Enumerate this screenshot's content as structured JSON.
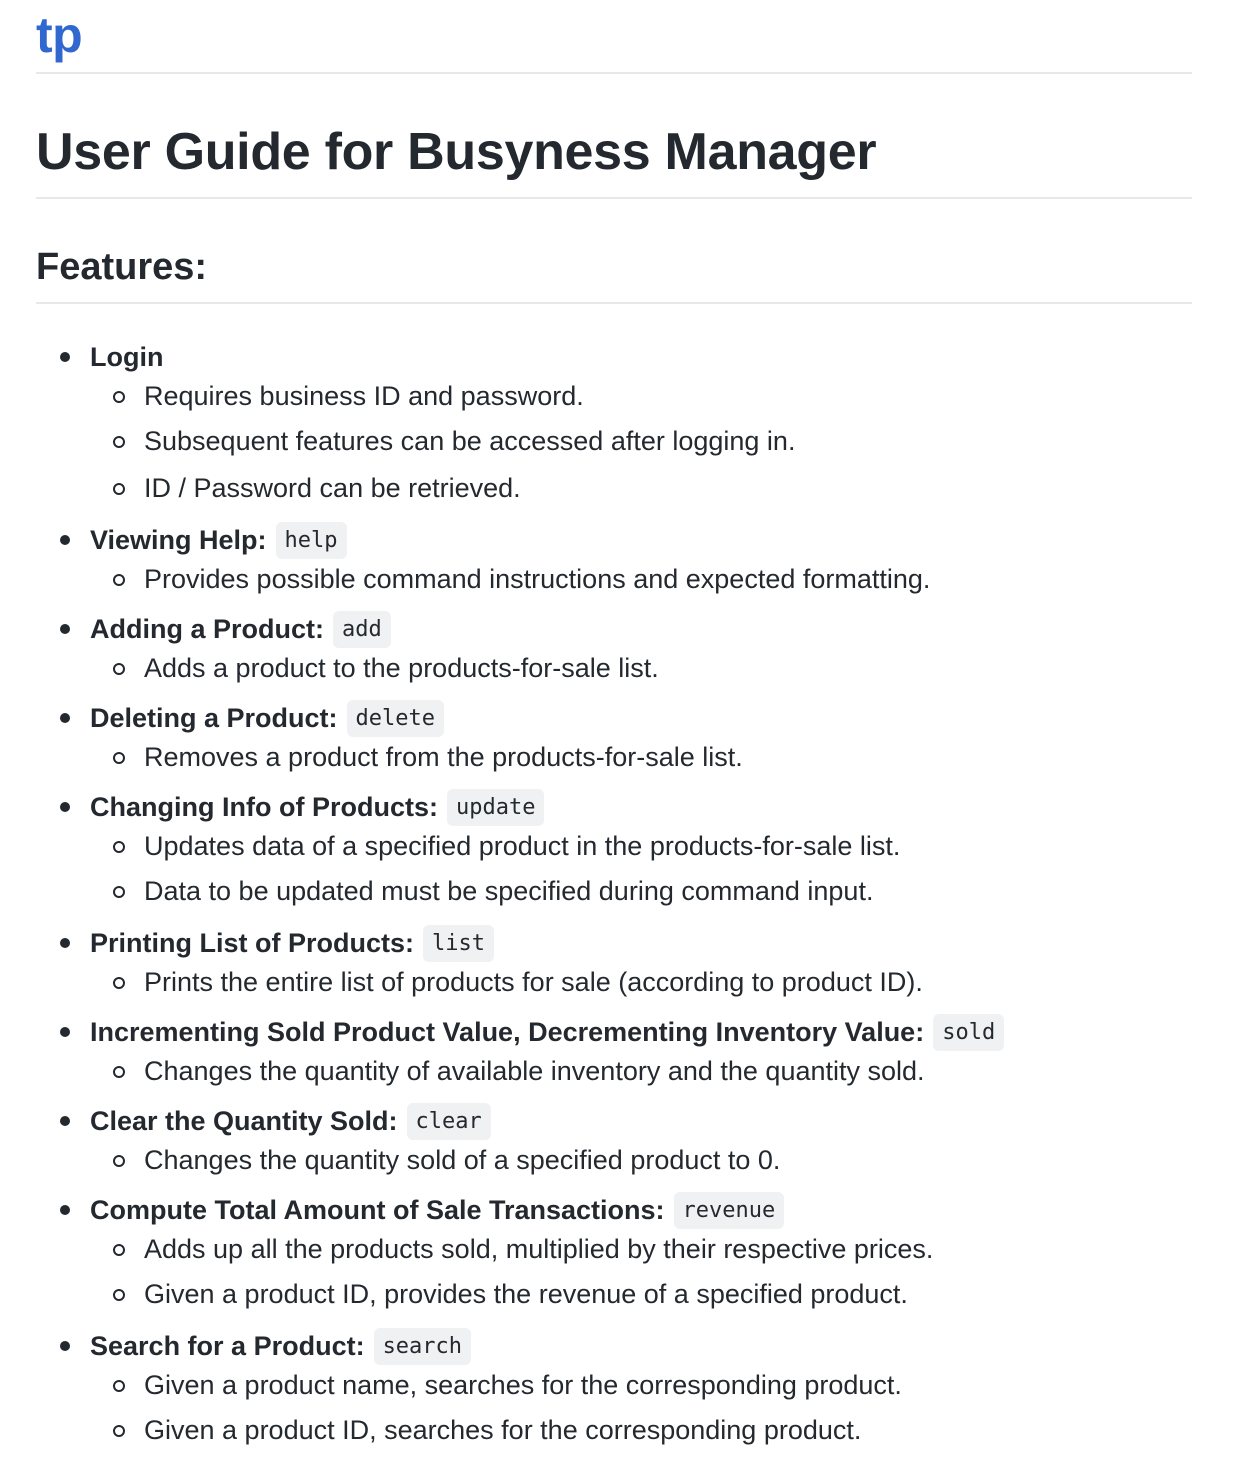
{
  "site": {
    "title": "tp"
  },
  "page": {
    "title": "User Guide for Busyness Manager",
    "section_heading": "Features:"
  },
  "features": [
    {
      "title": "Login",
      "command": "",
      "details": [
        "Requires business ID and password.",
        "Subsequent features can be accessed after logging in.",
        "ID / Password can be retrieved."
      ]
    },
    {
      "title": "Viewing Help:",
      "command": "help",
      "details": [
        "Provides possible command instructions and expected formatting."
      ]
    },
    {
      "title": "Adding a Product:",
      "command": "add",
      "details": [
        "Adds a product to the products-for-sale list."
      ]
    },
    {
      "title": "Deleting a Product:",
      "command": "delete",
      "details": [
        "Removes a product from the products-for-sale list."
      ]
    },
    {
      "title": "Changing Info of Products:",
      "command": "update",
      "details": [
        "Updates data of a specified product in the products-for-sale list.",
        "Data to be updated must be specified during command input."
      ]
    },
    {
      "title": "Printing List of Products:",
      "command": "list",
      "details": [
        "Prints the entire list of products for sale (according to product ID)."
      ]
    },
    {
      "title": "Incrementing Sold Product Value, Decrementing Inventory Value:",
      "command": "sold",
      "details": [
        "Changes the quantity of available inventory and the quantity sold."
      ]
    },
    {
      "title": "Clear the Quantity Sold:",
      "command": "clear",
      "details": [
        "Changes the quantity sold of a specified product to 0."
      ]
    },
    {
      "title": "Compute Total Amount of Sale Transactions:",
      "command": "revenue",
      "details": [
        "Adds up all the products sold, multiplied by their respective prices.",
        "Given a product ID, provides the revenue of a specified product."
      ]
    },
    {
      "title": "Search for a Product:",
      "command": "search",
      "details": [
        "Given a product name, searches for the corresponding product.",
        "Given a product ID, searches for the corresponding product."
      ]
    }
  ]
}
